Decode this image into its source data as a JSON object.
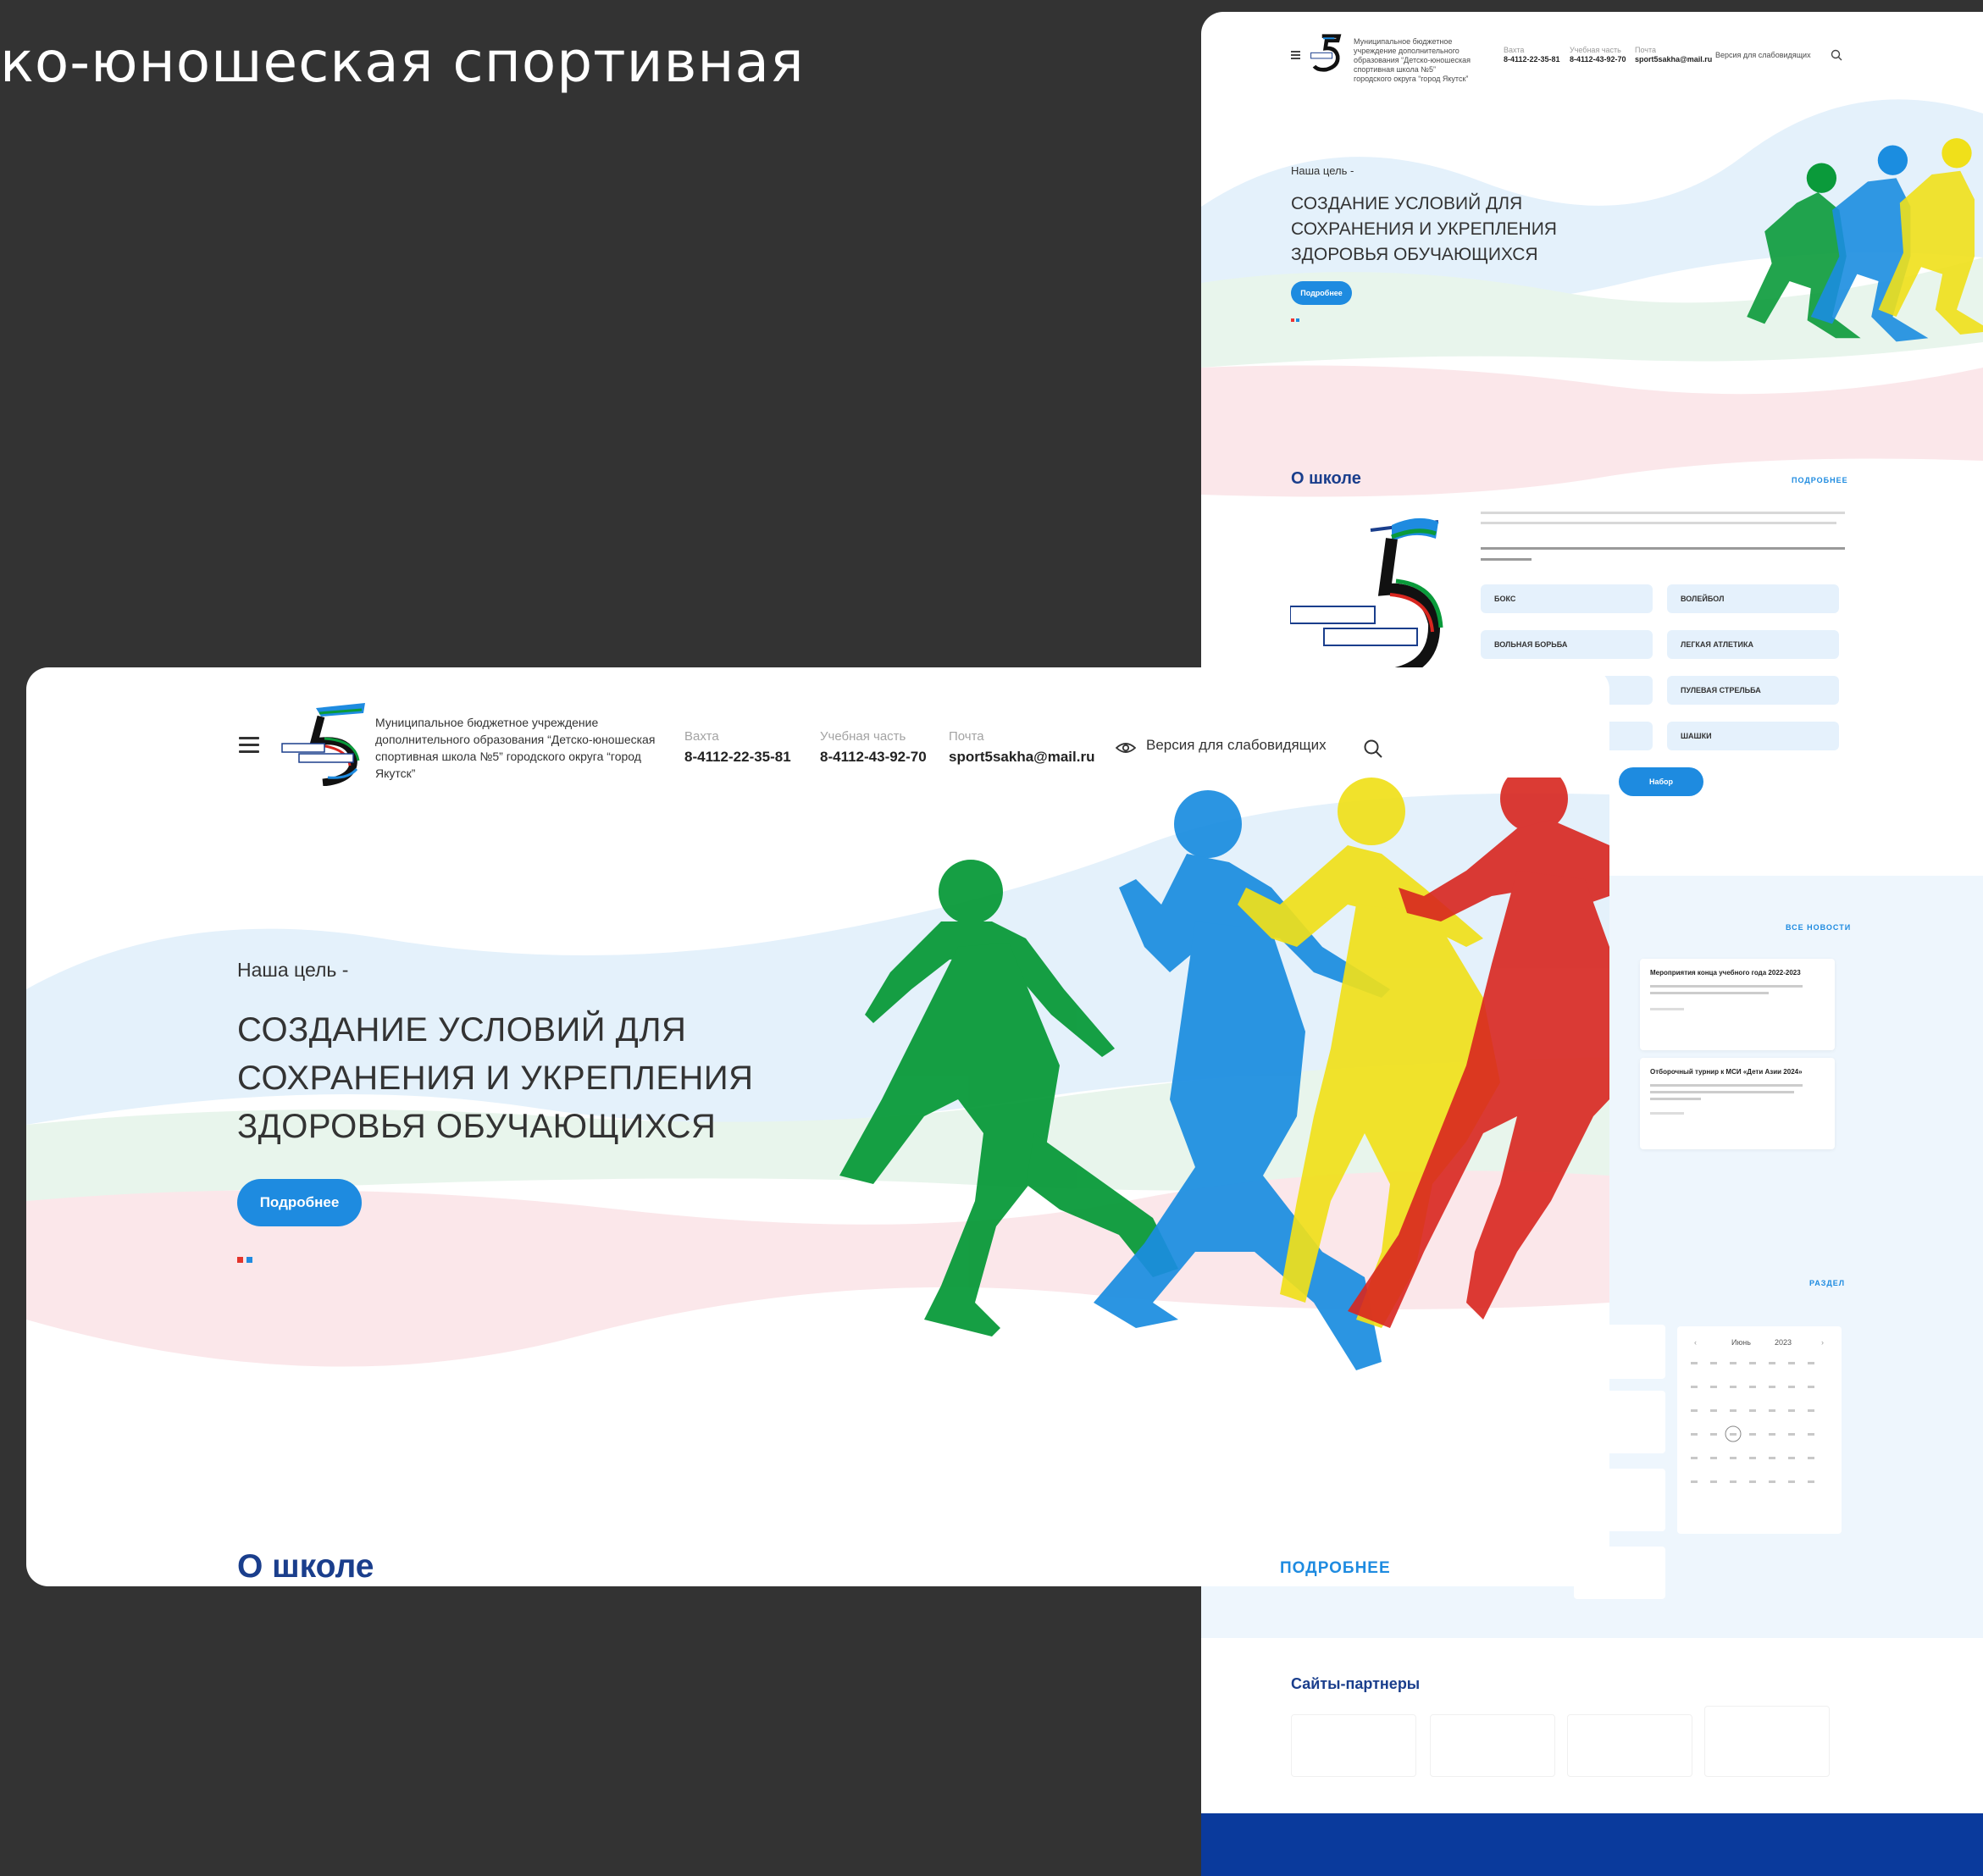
{
  "page_title_strip": "ко-юношеская спортивная",
  "colors": {
    "accent_blue": "#1e8be0",
    "dark_blue": "#1a3e8c",
    "footer_blue": "#0a3a9c",
    "runner_green": "#0a9a3a",
    "runner_blue": "#1b8de0",
    "runner_yellow": "#f0e01a",
    "runner_red": "#d8261f",
    "background": "#333333"
  },
  "header": {
    "org_name": "Муниципальное бюджетное учреждение дополнительного образования “Детско-юношеская спортивная школа №5” городского округа “город Якутск”",
    "contacts": [
      {
        "label": "Вахта",
        "value": "8-4112-22-35-81"
      },
      {
        "label": "Учебная часть",
        "value": "8-4112-43-92-70"
      },
      {
        "label": "Почта",
        "value": "sport5sakha@mail.ru"
      }
    ],
    "vision_label": "Версия для слабовидящих",
    "menu_icon": "hamburger-icon",
    "search_icon": "search-icon",
    "eye_icon": "eye-icon"
  },
  "hero": {
    "goal_label": "Наша цель -",
    "heading_line1": "СОЗДАНИЕ УСЛОВИЙ ДЛЯ",
    "heading_line2": "СОХРАНЕНИЯ И УКРЕПЛЕНИЯ",
    "heading_line3": "ЗДОРОВЬЯ ОБУЧАЮЩИХСЯ",
    "button_label": "Подробнее"
  },
  "about": {
    "title": "О школе",
    "more_label": "ПОДРОБНЕЕ"
  },
  "mockup": {
    "about_more": "ПОДРОБНЕЕ",
    "sports": [
      "БОКС",
      "ВОЛЕЙБОЛ",
      "ВОЛЬНАЯ БОРЬБА",
      "ЛЕГКАЯ АТЛЕТИКА",
      "ПУЛЕВАЯ СТРЕЛЬБА",
      "ШАШКИ"
    ],
    "enroll_label": "Набор",
    "news_more": "ВСЕ НОВОСТИ",
    "news": [
      {
        "title": "Мероприятия конца учебного года 2022-2023"
      },
      {
        "title": "Отборочный турнир к МСИ «Дети Азии 2024»"
      }
    ],
    "section_more": "РАЗДЕЛ",
    "calendar_month": "Июнь",
    "calendar_year": "2023",
    "partners_title": "Сайты-партнеры"
  }
}
